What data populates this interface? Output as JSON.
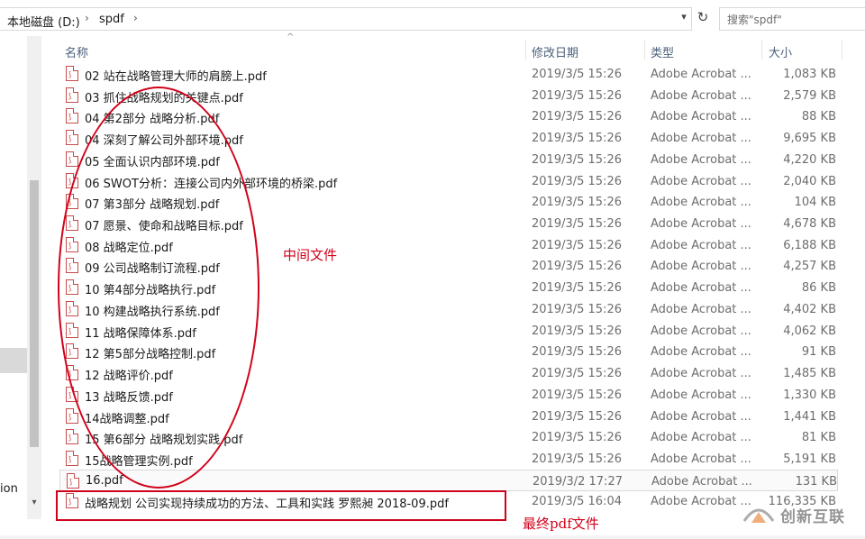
{
  "address_bar": {
    "crumbs": [
      "本地磁盘 (D:)",
      "spdf"
    ],
    "search_placeholder": "搜索\"spdf\""
  },
  "nav_pane": {
    "partial_label": "ion"
  },
  "columns": {
    "name": "名称",
    "date": "修改日期",
    "type": "类型",
    "size": "大小"
  },
  "files": [
    {
      "name": "02 站在战略管理大师的肩膀上.pdf",
      "date": "2019/3/5 15:26",
      "type": "Adobe Acrobat ...",
      "size": "1,083 KB"
    },
    {
      "name": "03 抓住战略规划的关键点.pdf",
      "date": "2019/3/5 15:26",
      "type": "Adobe Acrobat ...",
      "size": "2,579 KB"
    },
    {
      "name": "04 第2部分 战略分析.pdf",
      "date": "2019/3/5 15:26",
      "type": "Adobe Acrobat ...",
      "size": "88 KB"
    },
    {
      "name": "04 深刻了解公司外部环境.pdf",
      "date": "2019/3/5 15:26",
      "type": "Adobe Acrobat ...",
      "size": "9,695 KB"
    },
    {
      "name": "05 全面认识内部环境.pdf",
      "date": "2019/3/5 15:26",
      "type": "Adobe Acrobat ...",
      "size": "4,220 KB"
    },
    {
      "name": "06 SWOT分析：连接公司内外部环境的桥梁.pdf",
      "date": "2019/3/5 15:26",
      "type": "Adobe Acrobat ...",
      "size": "2,040 KB"
    },
    {
      "name": "07 第3部分 战略规划.pdf",
      "date": "2019/3/5 15:26",
      "type": "Adobe Acrobat ...",
      "size": "104 KB"
    },
    {
      "name": "07 愿景、使命和战略目标.pdf",
      "date": "2019/3/5 15:26",
      "type": "Adobe Acrobat ...",
      "size": "4,678 KB"
    },
    {
      "name": "08 战略定位.pdf",
      "date": "2019/3/5 15:26",
      "type": "Adobe Acrobat ...",
      "size": "6,188 KB"
    },
    {
      "name": "09 公司战略制订流程.pdf",
      "date": "2019/3/5 15:26",
      "type": "Adobe Acrobat ...",
      "size": "4,257 KB"
    },
    {
      "name": "10 第4部分战略执行.pdf",
      "date": "2019/3/5 15:26",
      "type": "Adobe Acrobat ...",
      "size": "86 KB"
    },
    {
      "name": "10 构建战略执行系统.pdf",
      "date": "2019/3/5 15:26",
      "type": "Adobe Acrobat ...",
      "size": "4,402 KB"
    },
    {
      "name": "11 战略保障体系.pdf",
      "date": "2019/3/5 15:26",
      "type": "Adobe Acrobat ...",
      "size": "4,062 KB"
    },
    {
      "name": "12 第5部分战略控制.pdf",
      "date": "2019/3/5 15:26",
      "type": "Adobe Acrobat ...",
      "size": "91 KB"
    },
    {
      "name": "12 战略评价.pdf",
      "date": "2019/3/5 15:26",
      "type": "Adobe Acrobat ...",
      "size": "1,485 KB"
    },
    {
      "name": "13 战略反馈.pdf",
      "date": "2019/3/5 15:26",
      "type": "Adobe Acrobat ...",
      "size": "1,330 KB"
    },
    {
      "name": "14战略调整.pdf",
      "date": "2019/3/5 15:26",
      "type": "Adobe Acrobat ...",
      "size": "1,441 KB"
    },
    {
      "name": "15 第6部分 战略规划实践.pdf",
      "date": "2019/3/5 15:26",
      "type": "Adobe Acrobat ...",
      "size": "81 KB"
    },
    {
      "name": "15战略管理实例.pdf",
      "date": "2019/3/5 15:26",
      "type": "Adobe Acrobat ...",
      "size": "5,191 KB"
    },
    {
      "name": "16.pdf",
      "date": "2019/3/2 17:27",
      "type": "Adobe Acrobat ...",
      "size": "131 KB"
    },
    {
      "name": "战略规划 公司实现持续成功的方法、工具和实践 罗熙昶 2018-09.pdf",
      "date": "2019/3/5 16:04",
      "type": "Adobe Acrobat ...",
      "size": "116,335 KB"
    }
  ],
  "annotations": {
    "middle_files": "中间文件",
    "final_pdf": "最终pdf文件"
  },
  "watermark": {
    "text": "创新互联"
  },
  "colors": {
    "annotation_red": "#d0021b",
    "header_text": "#4c607a",
    "pdf_icon_red": "#d2312b"
  }
}
